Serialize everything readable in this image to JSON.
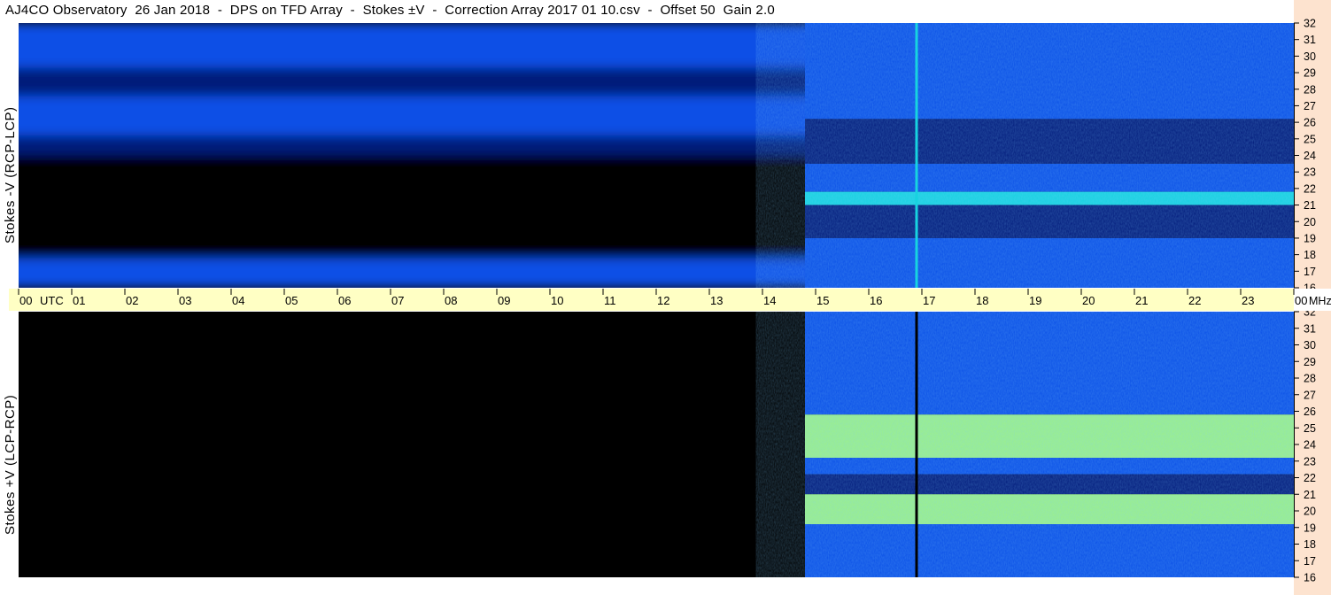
{
  "title": "AJ4CO Observatory  26 Jan 2018  -  DPS on TFD Array  -  Stokes ±V  -  Correction Array 2017 01 10.csv  -  Offset 50  Gain 2.0",
  "colors": {
    "background": "#ffffff",
    "time_axis_bg": "#ffffc4",
    "freq_axis_bg": "#fde3cf",
    "blue_mid": "#0a4fe6",
    "blue_dark": "#021a7a",
    "cyan": "#17d3e0",
    "green": "#9cf08a"
  },
  "chart_data": {
    "type": "heatmap",
    "title": "AJ4CO Observatory  26 Jan 2018  -  DPS on TFD Array  -  Stokes ±V  -  Correction Array 2017 01 10.csv  -  Offset 50  Gain 2.0",
    "x_axis": {
      "unit_label": "UTC",
      "range_hours": [
        0,
        24
      ],
      "tick_labels": [
        "00",
        "01",
        "02",
        "03",
        "04",
        "05",
        "06",
        "07",
        "08",
        "09",
        "10",
        "11",
        "12",
        "13",
        "14",
        "15",
        "16",
        "17",
        "18",
        "19",
        "20",
        "21",
        "22",
        "23",
        "00"
      ]
    },
    "y_axis": {
      "unit_label": "MHz",
      "range_mhz": [
        16,
        32
      ],
      "tick_labels": [
        "32",
        "31",
        "30",
        "29",
        "28",
        "27",
        "26",
        "25",
        "24",
        "23",
        "22",
        "21",
        "20",
        "19",
        "18",
        "17",
        "16"
      ]
    },
    "panels": [
      {
        "id": "top",
        "ylabel": "Stokes -V (RCP-LCP)",
        "synthetic_until_hour": 14.8,
        "synthetic_bands": [
          {
            "from_mhz": 32,
            "to_mhz": 29.3,
            "level": "mid"
          },
          {
            "from_mhz": 29.3,
            "to_mhz": 27.6,
            "level": "dark"
          },
          {
            "from_mhz": 27.6,
            "to_mhz": 25.2,
            "level": "mid"
          },
          {
            "from_mhz": 25.2,
            "to_mhz": 24,
            "level": "dark"
          },
          {
            "from_mhz": 24,
            "to_mhz": 17.8,
            "level": "black"
          },
          {
            "from_mhz": 17.8,
            "to_mhz": 16,
            "level": "mid"
          }
        ],
        "measured_from_hour": 14.8,
        "measured_bands": [
          {
            "from_mhz": 32,
            "to_mhz": 26.2,
            "level": "mid"
          },
          {
            "from_mhz": 26.2,
            "to_mhz": 23.5,
            "level": "dark"
          },
          {
            "from_mhz": 23.5,
            "to_mhz": 21.8,
            "level": "mid"
          },
          {
            "from_mhz": 21.8,
            "to_mhz": 21.0,
            "level": "cyan"
          },
          {
            "from_mhz": 21.0,
            "to_mhz": 19.0,
            "level": "dark"
          },
          {
            "from_mhz": 19.0,
            "to_mhz": 16,
            "level": "mid"
          }
        ],
        "vertical_line_hour": 16.9,
        "vertical_line_level": "cyan"
      },
      {
        "id": "bottom",
        "ylabel": "Stokes +V (LCP-RCP)",
        "synthetic_until_hour": 14.8,
        "synthetic_bands": [
          {
            "from_mhz": 32,
            "to_mhz": 16,
            "level": "black"
          }
        ],
        "measured_from_hour": 14.8,
        "measured_bands": [
          {
            "from_mhz": 32,
            "to_mhz": 25.8,
            "level": "mid"
          },
          {
            "from_mhz": 25.8,
            "to_mhz": 23.2,
            "level": "green"
          },
          {
            "from_mhz": 23.2,
            "to_mhz": 22.2,
            "level": "mid"
          },
          {
            "from_mhz": 22.2,
            "to_mhz": 21.0,
            "level": "dark"
          },
          {
            "from_mhz": 21.0,
            "to_mhz": 19.2,
            "level": "green"
          },
          {
            "from_mhz": 19.2,
            "to_mhz": 16,
            "level": "mid"
          }
        ],
        "vertical_line_hour": 16.9,
        "vertical_line_level": "black"
      }
    ]
  }
}
